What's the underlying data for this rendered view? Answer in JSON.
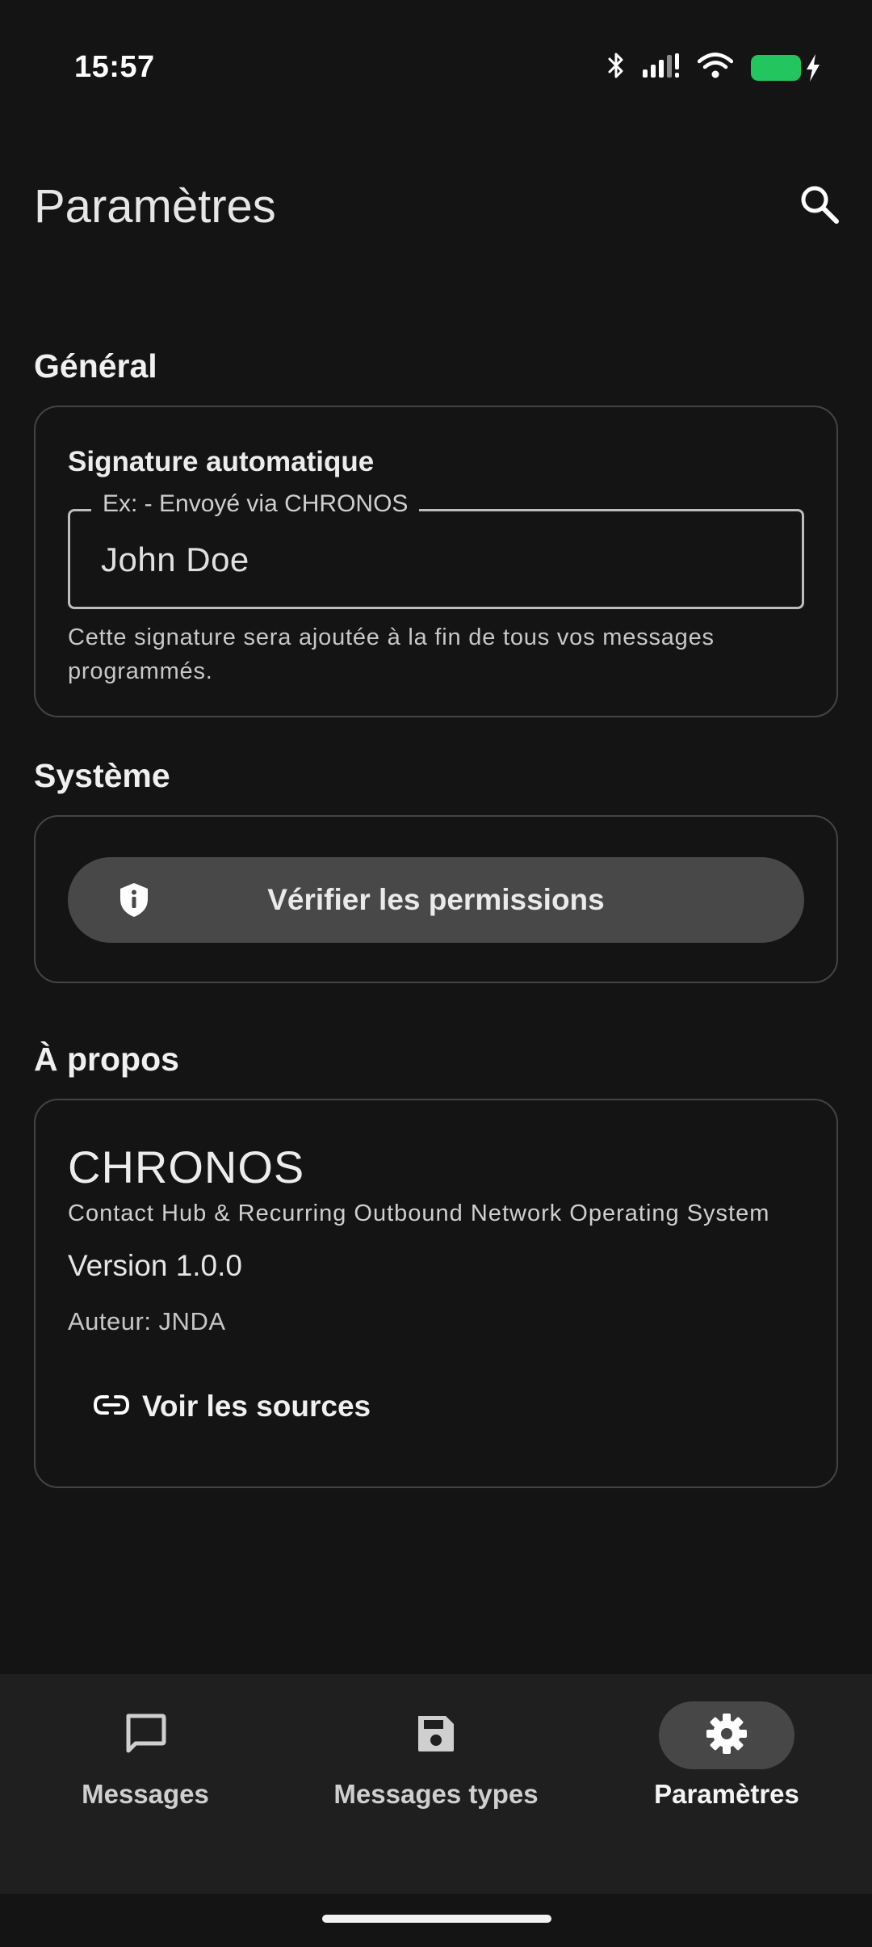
{
  "status_bar": {
    "time": "15:57",
    "icons": [
      "bluetooth-icon",
      "signal-icon",
      "wifi-icon",
      "battery-icon"
    ],
    "battery_color": "#22c55e"
  },
  "app_bar": {
    "title": "Paramètres",
    "search_icon": "search-icon"
  },
  "general": {
    "header": "Général",
    "signature_title": "Signature automatique",
    "field_label": "Ex: - Envoyé via CHRONOS",
    "field_value": "John Doe",
    "helper": "Cette signature sera ajoutée à la fin de tous vos messages programmés."
  },
  "system": {
    "header": "Système",
    "permissions_label": "Vérifier les permissions",
    "permissions_icon": "shield-info-icon"
  },
  "about": {
    "header": "À propos",
    "app_name": "CHRONOS",
    "expansion": "Contact Hub & Recurring Outbound Network Operating System",
    "version": "Version 1.0.0",
    "author": "Auteur: JNDA",
    "sources_label": "Voir les sources",
    "sources_icon": "link-icon"
  },
  "bottom_nav": {
    "items": [
      {
        "label": "Messages",
        "icon": "chat-bubble-icon",
        "active": false
      },
      {
        "label": "Messages types",
        "icon": "save-icon",
        "active": false
      },
      {
        "label": "Paramètres",
        "icon": "gear-icon",
        "active": true
      }
    ]
  },
  "colors": {
    "background": "#141414",
    "card_border": "#444444",
    "button_fill": "#484848",
    "nav_background": "#1f1f1f",
    "nav_active_pill": "#474747"
  }
}
